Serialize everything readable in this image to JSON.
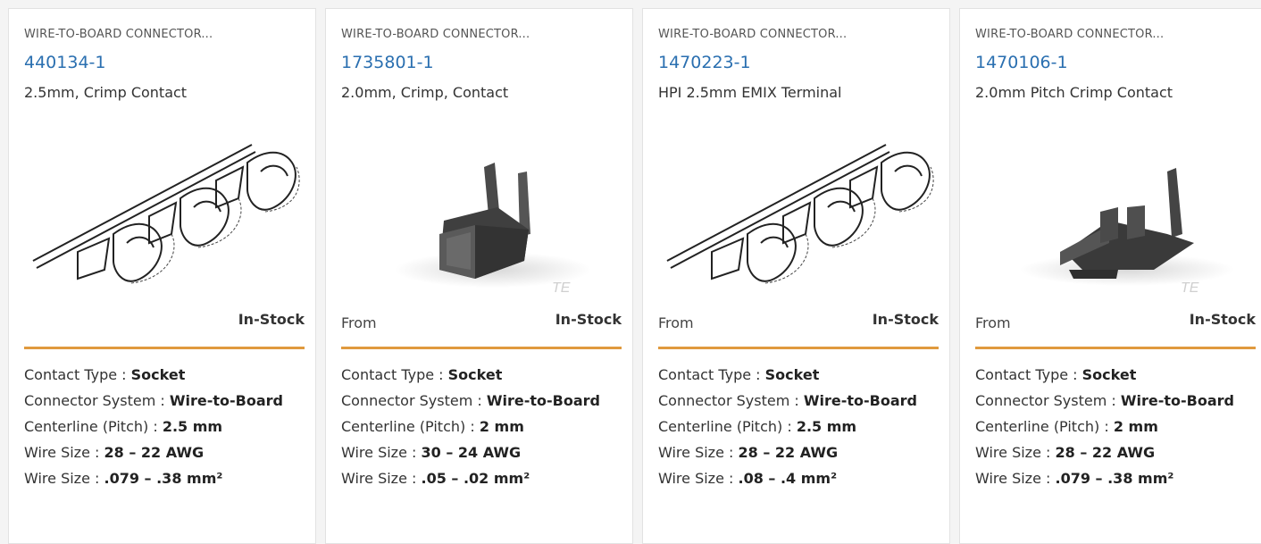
{
  "products": [
    {
      "category": "WIRE-TO-BOARD CONNECTOR...",
      "part_number": "440134-1",
      "description": "2.5mm, Crimp Contact",
      "image_icon": "crimp-contact-strip-drawing",
      "from_label": "",
      "stock": "In-Stock",
      "specs": [
        {
          "label": "Contact Type :",
          "value": "Socket"
        },
        {
          "label": "Connector System :",
          "value": "Wire-to-Board"
        },
        {
          "label": "Centerline (Pitch) :",
          "value": "2.5 mm"
        },
        {
          "label": "Wire Size :",
          "value": "28 – 22 AWG"
        },
        {
          "label": "Wire Size :",
          "value": ".079 – .38 mm²"
        }
      ]
    },
    {
      "category": "WIRE-TO-BOARD CONNECTOR...",
      "part_number": "1735801-1",
      "description": "2.0mm, Crimp, Contact",
      "image_icon": "crimp-contact-render",
      "watermark": "TE",
      "from_label": "From",
      "stock": "In-Stock",
      "specs": [
        {
          "label": "Contact Type :",
          "value": "Socket"
        },
        {
          "label": "Connector System :",
          "value": "Wire-to-Board"
        },
        {
          "label": "Centerline (Pitch) :",
          "value": "2 mm"
        },
        {
          "label": "Wire Size :",
          "value": "30 – 24 AWG"
        },
        {
          "label": "Wire Size :",
          "value": ".05 – .02 mm²"
        }
      ]
    },
    {
      "category": "WIRE-TO-BOARD CONNECTOR...",
      "part_number": "1470223-1",
      "description": "HPI 2.5mm EMIX Terminal",
      "image_icon": "crimp-contact-strip-drawing",
      "from_label": "From",
      "stock": "In-Stock",
      "specs": [
        {
          "label": "Contact Type :",
          "value": "Socket"
        },
        {
          "label": "Connector System :",
          "value": "Wire-to-Board"
        },
        {
          "label": "Centerline (Pitch) :",
          "value": "2.5 mm"
        },
        {
          "label": "Wire Size :",
          "value": "28 – 22 AWG"
        },
        {
          "label": "Wire Size :",
          "value": ".08 – .4 mm²"
        }
      ]
    },
    {
      "category": "WIRE-TO-BOARD CONNECTOR...",
      "part_number": "1470106-1",
      "description": "2.0mm Pitch Crimp Contact",
      "image_icon": "crimp-contact-render",
      "watermark": "TE",
      "from_label": "From",
      "stock": "In-Stock",
      "specs": [
        {
          "label": "Contact Type :",
          "value": "Socket"
        },
        {
          "label": "Connector System :",
          "value": "Wire-to-Board"
        },
        {
          "label": "Centerline (Pitch) :",
          "value": "2 mm"
        },
        {
          "label": "Wire Size :",
          "value": "28 – 22 AWG"
        },
        {
          "label": "Wire Size :",
          "value": ".079 – .38 mm²"
        }
      ]
    }
  ],
  "colors": {
    "link": "#2a6fb0",
    "accent_rule": "#e09a3e"
  }
}
